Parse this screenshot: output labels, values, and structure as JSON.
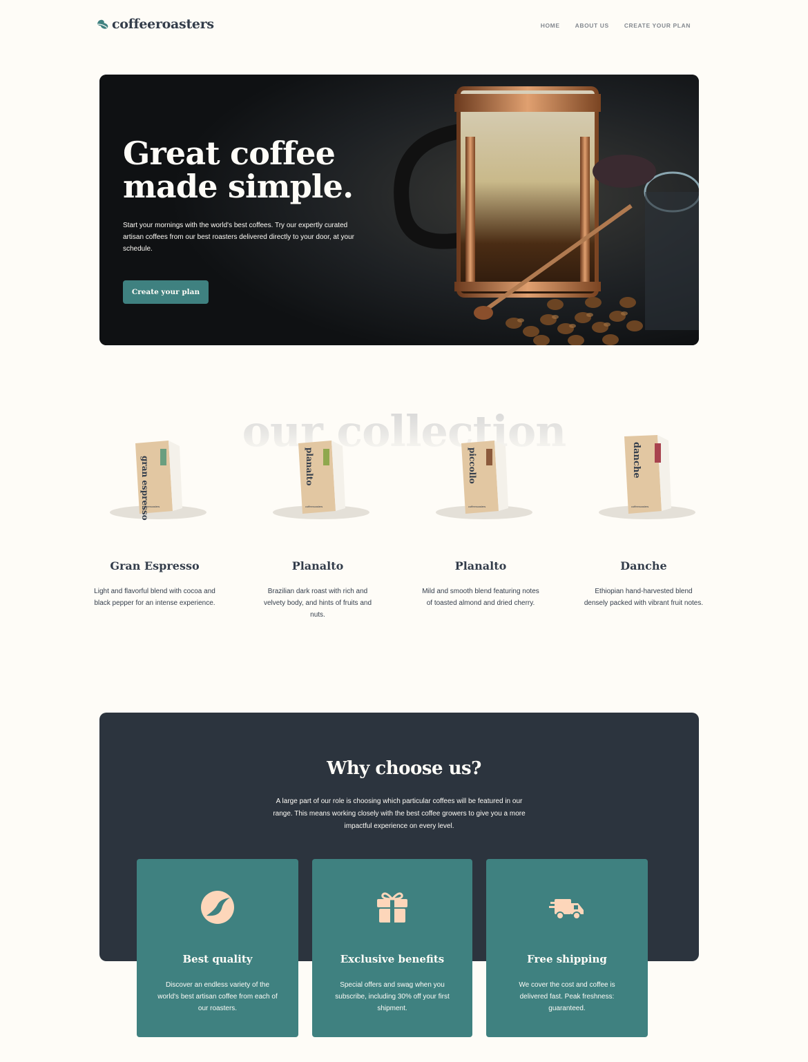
{
  "header": {
    "brand": "coffeeroasters",
    "nav": [
      "HOME",
      "ABOUT US",
      "CREATE YOUR PLAN"
    ]
  },
  "hero": {
    "title_line1": "Great coffee",
    "title_line2": "made simple.",
    "description": "Start your mornings with the world's best coffees. Try our expertly curated artisan coffees from our best roasters delivered directly to your door, at your schedule.",
    "cta": "Create your plan"
  },
  "collection": {
    "heading": "our collection",
    "items": [
      {
        "name": "Gran Espresso",
        "bag_label": "gran espresso",
        "desc": "Light and flavorful blend with cocoa and black pepper for an intense experience.",
        "accent": "#6a9e7f"
      },
      {
        "name": "Planalto",
        "bag_label": "planalto",
        "desc": "Brazilian dark roast with rich and velvety body, and hints of fruits and nuts.",
        "accent": "#8fa84e"
      },
      {
        "name": "Planalto",
        "bag_label": "piccollo",
        "desc": "Mild and smooth blend featuring notes of toasted almond and dried cherry.",
        "accent": "#8b5a3c"
      },
      {
        "name": "Danche",
        "bag_label": "danche",
        "desc": "Ethiopian hand-harvested blend densely packed with vibrant fruit notes.",
        "accent": "#a8434e"
      }
    ],
    "bag_brand": "coffeeroasters"
  },
  "why": {
    "title": "Why choose us?",
    "description": "A large part of our role is choosing which particular coffees will be featured in our range. This means working closely with the best coffee growers to give you a more impactful experience on every level.",
    "cards": [
      {
        "icon": "coffee-bean-icon",
        "title": "Best quality",
        "desc": "Discover an endless variety of the world's best artisan coffee from each of our roasters."
      },
      {
        "icon": "gift-icon",
        "title": "Exclusive benefits",
        "desc": "Special offers and swag when you subscribe, including 30% off your first shipment."
      },
      {
        "icon": "truck-icon",
        "title": "Free shipping",
        "desc": "We cover the cost and coffee is delivered fast. Peak freshness: guaranteed."
      }
    ]
  },
  "colors": {
    "accent": "#3f8180",
    "dark": "#2c343e",
    "background": "#fefcf7",
    "icon": "#fdd6ba"
  }
}
